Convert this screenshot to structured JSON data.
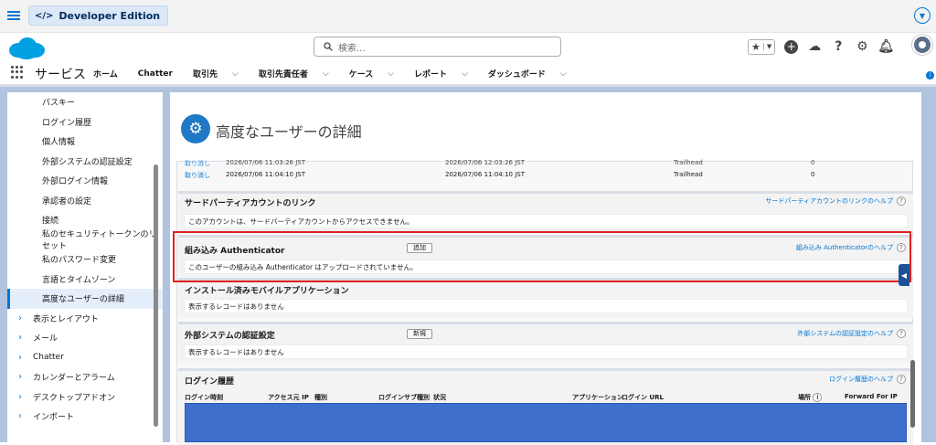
{
  "topbar": {
    "edition": "Developer Edition"
  },
  "header": {
    "search_placeholder": "検索..."
  },
  "nav": {
    "app_name": "サービス",
    "items": [
      {
        "label": "ホーム",
        "dropdown": false
      },
      {
        "label": "Chatter",
        "dropdown": false
      },
      {
        "label": "取引先",
        "dropdown": true
      },
      {
        "label": "取引先責任者",
        "dropdown": true
      },
      {
        "label": "ケース",
        "dropdown": true
      },
      {
        "label": "レポート",
        "dropdown": true
      },
      {
        "label": "ダッシュボード",
        "dropdown": true
      }
    ]
  },
  "sidebar": {
    "items": [
      "パスキー",
      "ログイン履歴",
      "個人情報",
      "外部システムの認証設定",
      "外部ログイン情報",
      "承認者の設定",
      "接続",
      "私のセキュリティトークンのリセット",
      "私のパスワード変更",
      "言語とタイムゾーン",
      "高度なユーザーの詳細"
    ],
    "active": "高度なユーザーの詳細",
    "groups": [
      "表示とレイアウト",
      "メール",
      "Chatter",
      "カレンダーとアラーム",
      "デスクトップアドオン",
      "インポート"
    ]
  },
  "page": {
    "title": "高度なユーザーの詳細"
  },
  "rows": [
    {
      "link": "取り消し",
      "date1": "2026/07/06 11:03:26 JST",
      "date2": "2026/07/06 12:03:26 JST",
      "app": "Trailhead",
      "count": "0"
    },
    {
      "link": "取り消し",
      "date1": "2026/07/06 11:04:10 JST",
      "date2": "2026/07/06 11:04:10 JST",
      "app": "Trailhead",
      "count": "0"
    }
  ],
  "sections": {
    "third_party": {
      "title": "サードパーティアカウントのリンク",
      "help": "サードパーティアカウントのリンクのヘルプ",
      "body": "このアカウントは、サードパーティアカウントからアクセスできません。"
    },
    "authenticator": {
      "title": "組み込み Authenticator",
      "button": "追加",
      "help": "組み込み Authenticatorのヘルプ",
      "body": "このユーザーの組み込み Authenticator はアップロードされていません。"
    },
    "mobile_apps": {
      "title": "インストール済みモバイルアプリケーション",
      "body": "表示するレコードはありません"
    },
    "external_auth": {
      "title": "外部システムの認証設定",
      "button": "新規",
      "help": "外部システムの認証設定のヘルプ",
      "body": "表示するレコードはありません"
    },
    "login_history": {
      "title": "ログイン履歴",
      "help": "ログイン履歴のヘルプ",
      "columns": [
        "ログイン時刻",
        "アクセス元 IP",
        "種別",
        "ログインサブ種別",
        "状況",
        "アプリケーション",
        "ログイン URL",
        "場所",
        "Forward For IP"
      ]
    }
  }
}
